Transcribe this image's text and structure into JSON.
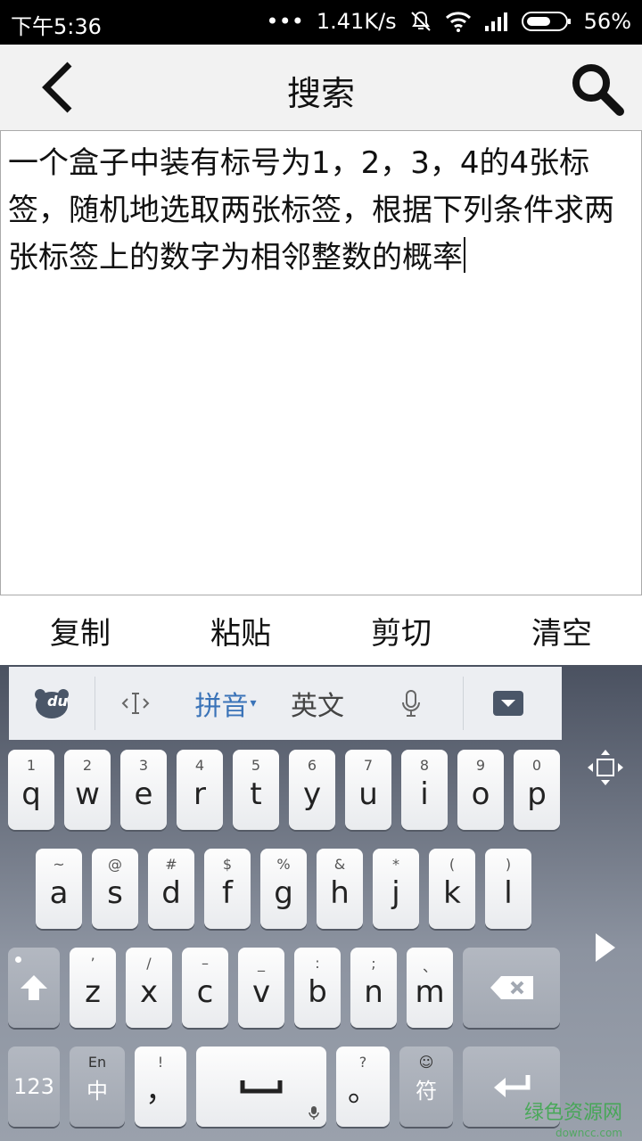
{
  "status": {
    "time": "下午5:36",
    "dots": "•••",
    "speed": "1.41K/s",
    "battery": "56%"
  },
  "header": {
    "title": "搜索"
  },
  "editor": {
    "text": "一个盒子中装有标号为1，2，3，4的4张标签，随机地选取两张标签，根据下列条件求两张标签上的数字为相邻整数的概率"
  },
  "actions": {
    "copy": "复制",
    "paste": "粘贴",
    "cut": "剪切",
    "clear": "清空"
  },
  "keyboard": {
    "toolbar": {
      "logo": "du",
      "pinyin": "拼音",
      "english": "英文"
    },
    "row1": [
      {
        "sup": "1",
        "key": "q"
      },
      {
        "sup": "2",
        "key": "w"
      },
      {
        "sup": "3",
        "key": "e"
      },
      {
        "sup": "4",
        "key": "r"
      },
      {
        "sup": "5",
        "key": "t"
      },
      {
        "sup": "6",
        "key": "y"
      },
      {
        "sup": "7",
        "key": "u"
      },
      {
        "sup": "8",
        "key": "i"
      },
      {
        "sup": "9",
        "key": "o"
      },
      {
        "sup": "0",
        "key": "p"
      }
    ],
    "row2": [
      {
        "sup": "~",
        "key": "a"
      },
      {
        "sup": "@",
        "key": "s"
      },
      {
        "sup": "#",
        "key": "d"
      },
      {
        "sup": "$",
        "key": "f"
      },
      {
        "sup": "%",
        "key": "g"
      },
      {
        "sup": "&",
        "key": "h"
      },
      {
        "sup": "*",
        "key": "j"
      },
      {
        "sup": "(",
        "key": "k"
      },
      {
        "sup": ")",
        "key": "l"
      }
    ],
    "row3": [
      {
        "sup": "’",
        "key": "z"
      },
      {
        "sup": "/",
        "key": "x"
      },
      {
        "sup": "–",
        "key": "c"
      },
      {
        "sup": "_",
        "key": "v"
      },
      {
        "sup": ":",
        "key": "b"
      },
      {
        "sup": ";",
        "key": "n"
      },
      {
        "sup": "、",
        "key": "m"
      }
    ],
    "bottom": {
      "num": "123",
      "lang_sup": "En",
      "lang": "中",
      "comma_sup": "!",
      "comma": "，",
      "period_sup": "?",
      "period": "。",
      "symbol": "符"
    }
  },
  "watermark": {
    "text": "绿色资源网",
    "url": "downcc.com"
  }
}
